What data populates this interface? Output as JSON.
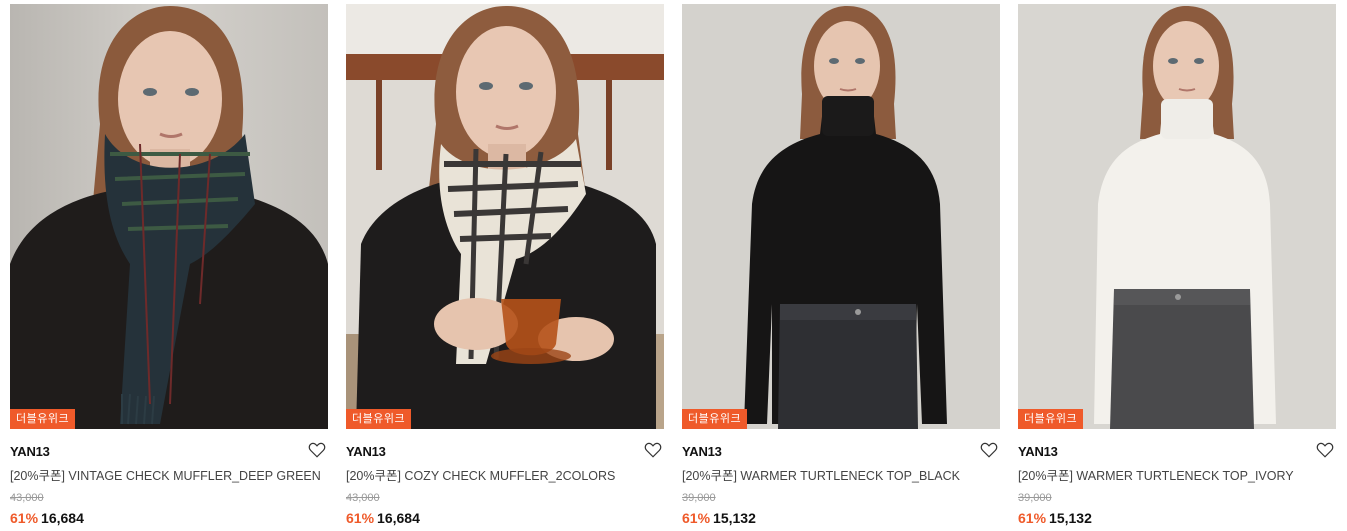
{
  "products": [
    {
      "badge": "더블유위크",
      "brand": "YAN13",
      "title": "[20%쿠폰] VINTAGE CHECK MUFFLER_DEEP GREEN",
      "original_price": "43,000",
      "discount": "61%",
      "price": "16,684"
    },
    {
      "badge": "더블유위크",
      "brand": "YAN13",
      "title": "[20%쿠폰] COZY CHECK MUFFLER_2COLORS",
      "original_price": "43,000",
      "discount": "61%",
      "price": "16,684"
    },
    {
      "badge": "더블유위크",
      "brand": "YAN13",
      "title": "[20%쿠폰] WARMER TURTLENECK TOP_BLACK",
      "original_price": "39,000",
      "discount": "61%",
      "price": "15,132"
    },
    {
      "badge": "더블유위크",
      "brand": "YAN13",
      "title": "[20%쿠폰] WARMER TURTLENECK TOP_IVORY",
      "original_price": "39,000",
      "discount": "61%",
      "price": "15,132"
    }
  ],
  "colors": {
    "accent": "#ef5a2a",
    "badge_text": "#ffffff",
    "original_price": "#999999"
  },
  "icons": {
    "wishlist": "heart-outline-icon"
  }
}
